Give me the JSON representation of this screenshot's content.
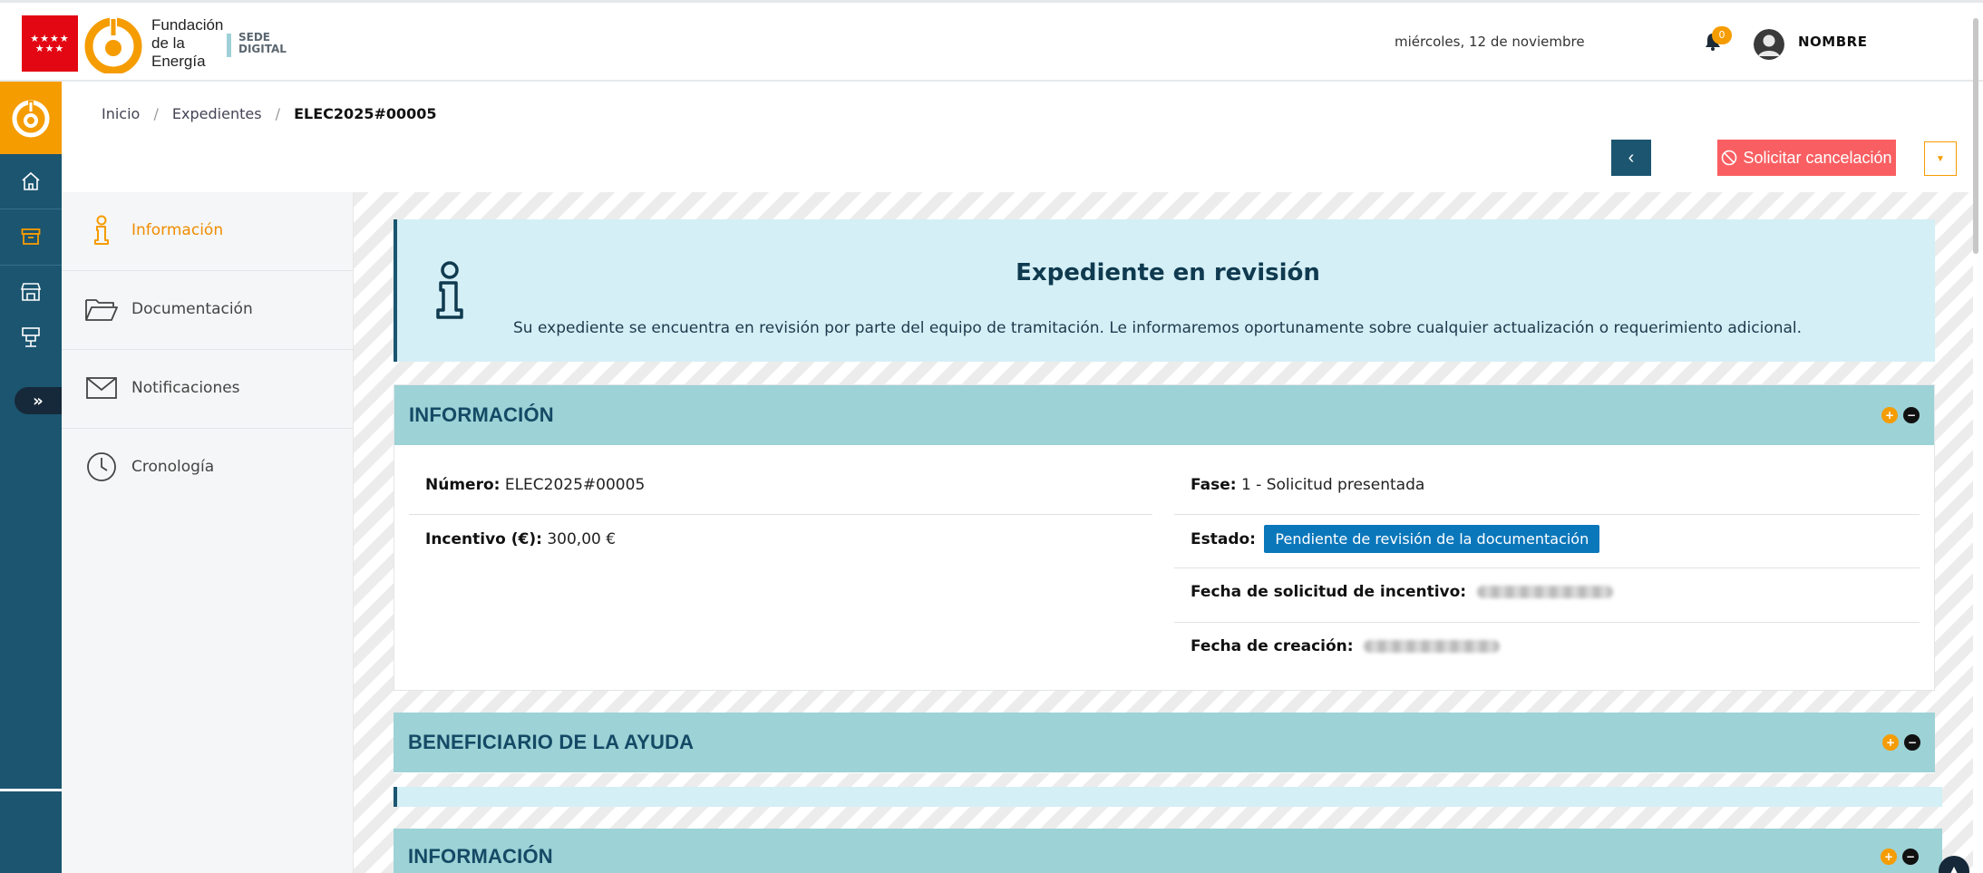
{
  "header": {
    "org_line1": "Fundación",
    "org_line2": "de la",
    "org_line3": "Energía",
    "sede_line1": "SEDE",
    "sede_line2": "DIGITAL",
    "date": "miércoles, 12 de noviembre",
    "notification_count": "0",
    "user_name": "NOMBRE"
  },
  "breadcrumb": {
    "items": [
      "Inicio",
      "Expedientes"
    ],
    "current": "ELEC2025#00005"
  },
  "toolbar": {
    "back_label": "‹",
    "cancel_label": "Solicitar cancelación",
    "dropdown_label": "▼"
  },
  "subnav": {
    "items": [
      {
        "label": "Información",
        "icon": "info-icon",
        "active": true
      },
      {
        "label": "Documentación",
        "icon": "folder-icon",
        "active": false
      },
      {
        "label": "Notificaciones",
        "icon": "envelope-icon",
        "active": false
      },
      {
        "label": "Cronología",
        "icon": "clock-icon",
        "active": false
      }
    ]
  },
  "alert": {
    "title": "Expediente en revisión",
    "text": "Su expediente se encuentra en revisión por parte del equipo de tramitación. Le informaremos oportunamente sobre cualquier actualización o requerimiento adicional."
  },
  "info_card": {
    "title": "INFORMACIÓN",
    "numero_label": "Número:",
    "numero_value": "ELEC2025#00005",
    "incentivo_label": "Incentivo (€):",
    "incentivo_value": "300,00 €",
    "fase_label": "Fase:",
    "fase_value": "1 - Solicitud presentada",
    "estado_label": "Estado:",
    "estado_value": "Pendiente de revisión de la documentación",
    "fecha_solicitud_label": "Fecha de solicitud de incentivo:",
    "fecha_creacion_label": "Fecha de creación:"
  },
  "beneficiario_card": {
    "title": "BENEFICIARIO DE LA AYUDA"
  },
  "info_card_2": {
    "title": "INFORMACIÓN"
  },
  "colors": {
    "primary": "#1b5570",
    "accent": "#f59c00",
    "danger": "#f95f62",
    "card_header": "#9dd2d6",
    "alert_bg": "#d4eff6",
    "badge": "#0b77bb"
  }
}
